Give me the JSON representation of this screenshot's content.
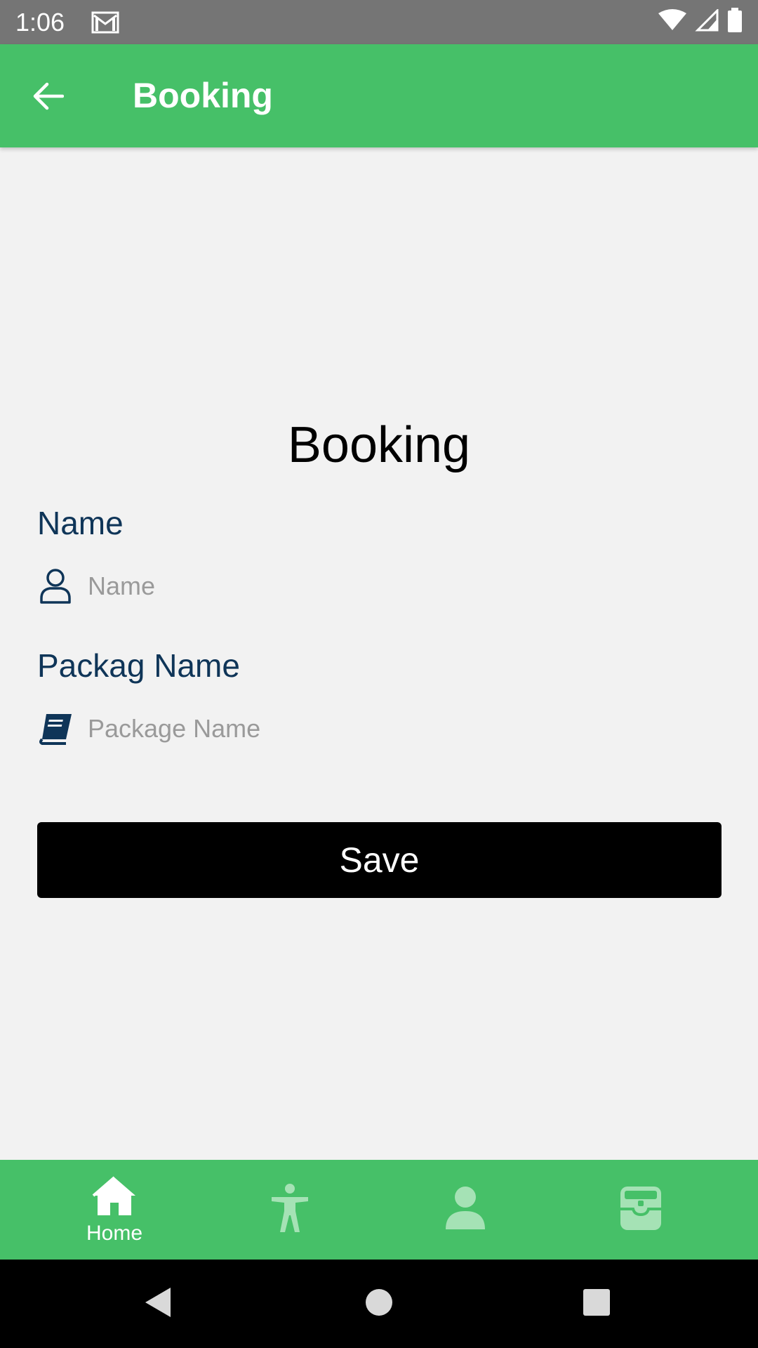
{
  "status_bar": {
    "time": "1:06",
    "icons": [
      "gmail-icon",
      "wifi-icon",
      "signal-icon",
      "battery-icon"
    ]
  },
  "app_bar": {
    "title": "Booking",
    "back_icon": "arrow-left-icon",
    "background_color": "#46c068"
  },
  "form": {
    "heading": "Booking",
    "name_label": "Name",
    "name_placeholder": "Name",
    "name_value": "",
    "name_icon": "user-outline-icon",
    "package_label": "Packag Name",
    "package_placeholder": "Package Name",
    "package_value": "",
    "package_icon": "book-icon",
    "save_label": "Save"
  },
  "bottom_nav": {
    "items": [
      {
        "icon": "home-icon",
        "label": "Home",
        "active": true
      },
      {
        "icon": "accessibility-icon",
        "label": "",
        "active": false
      },
      {
        "icon": "person-icon",
        "label": "",
        "active": false
      },
      {
        "icon": "inbox-icon",
        "label": "",
        "active": false
      }
    ]
  },
  "system_nav": {
    "icons": [
      "back-triangle-icon",
      "home-circle-icon",
      "recents-square-icon"
    ]
  },
  "colors": {
    "brand_green": "#46c068",
    "label_navy": "#0f3558",
    "button_black": "#000000"
  }
}
